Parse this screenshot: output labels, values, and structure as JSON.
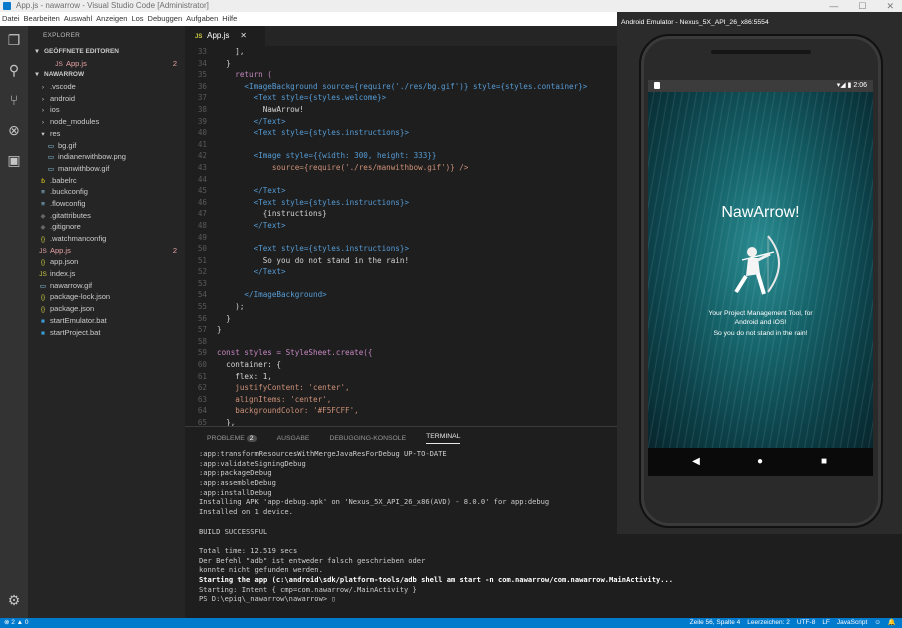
{
  "window": {
    "title": "App.js - nawarrow - Visual Studio Code [Administrator]",
    "controls": [
      "—",
      "☐",
      "✕"
    ]
  },
  "menu": [
    "Datei",
    "Bearbeiten",
    "Auswahl",
    "Anzeigen",
    "Los",
    "Debuggen",
    "Aufgaben",
    "Hilfe"
  ],
  "activity": {
    "icons": [
      "files-icon",
      "search-icon",
      "source-control-icon",
      "debug-icon",
      "extensions-icon",
      "settings-gear-icon"
    ]
  },
  "sidebar": {
    "header": "EXPLORER",
    "rows": [
      {
        "label": "GEÖFFNETE EDITOREN",
        "kind": "section",
        "indent": 4,
        "arrow": "▾"
      },
      {
        "label": "App.js",
        "kind": "file",
        "indent": 26,
        "icon": "JS",
        "color": "#e8a3a3",
        "count": "2"
      },
      {
        "label": "NAWARROW",
        "kind": "section",
        "indent": 4,
        "arrow": "▾"
      },
      {
        "label": ".vscode",
        "kind": "folder",
        "indent": 10,
        "arrow": "›"
      },
      {
        "label": "android",
        "kind": "folder",
        "indent": 10,
        "arrow": "›"
      },
      {
        "label": "ios",
        "kind": "folder",
        "indent": 10,
        "arrow": "›"
      },
      {
        "label": "node_modules",
        "kind": "folder",
        "indent": 10,
        "arrow": "›"
      },
      {
        "label": "res",
        "kind": "folder",
        "indent": 10,
        "arrow": "▾"
      },
      {
        "label": "bg.gif",
        "kind": "file",
        "indent": 18,
        "icon": "▭"
      },
      {
        "label": "indianerwithbow.png",
        "kind": "file",
        "indent": 18,
        "icon": "▭"
      },
      {
        "label": "manwithbow.gif",
        "kind": "file",
        "indent": 18,
        "icon": "▭"
      },
      {
        "label": ".babelrc",
        "kind": "file",
        "indent": 10,
        "icon": "ɓ",
        "iconColor": "#f5de19"
      },
      {
        "label": ".buckconfig",
        "kind": "file",
        "indent": 10,
        "icon": "≡"
      },
      {
        "label": ".flowconfig",
        "kind": "file",
        "indent": 10,
        "icon": "≡"
      },
      {
        "label": ".gitattributes",
        "kind": "file",
        "indent": 10,
        "icon": "◆",
        "iconColor": "#666"
      },
      {
        "label": ".gitignore",
        "kind": "file",
        "indent": 10,
        "icon": "◆",
        "iconColor": "#666"
      },
      {
        "label": ".watchmanconfig",
        "kind": "file",
        "indent": 10,
        "icon": "{}",
        "iconColor": "#cbcb41"
      },
      {
        "label": "App.js",
        "kind": "file",
        "indent": 10,
        "icon": "JS",
        "color": "#e8a3a3",
        "count": "2"
      },
      {
        "label": "app.json",
        "kind": "file",
        "indent": 10,
        "icon": "{}",
        "iconColor": "#cbcb41"
      },
      {
        "label": "index.js",
        "kind": "file",
        "indent": 10,
        "icon": "JS",
        "iconColor": "#cbcb41"
      },
      {
        "label": "nawarrow.gif",
        "kind": "file",
        "indent": 10,
        "icon": "▭"
      },
      {
        "label": "package-lock.json",
        "kind": "file",
        "indent": 10,
        "icon": "{}",
        "iconColor": "#cbcb41"
      },
      {
        "label": "package.json",
        "kind": "file",
        "indent": 10,
        "icon": "{}",
        "iconColor": "#cbcb41"
      },
      {
        "label": "startEmulator.bat",
        "kind": "file",
        "indent": 10,
        "icon": "■",
        "iconColor": "#3c9bd6"
      },
      {
        "label": "startProject.bat",
        "kind": "file",
        "indent": 10,
        "icon": "■",
        "iconColor": "#3c9bd6"
      }
    ]
  },
  "editor": {
    "tab": {
      "label": "App.js",
      "icon": "JS",
      "close": "✕"
    },
    "lines": [
      {
        "n": "33",
        "t": "    ],"
      },
      {
        "n": "34",
        "t": "  }"
      },
      {
        "n": "35",
        "t": "    return ("
      },
      {
        "n": "36",
        "t": "      <ImageBackground source={require('./res/bg.gif')} style={styles.container}>"
      },
      {
        "n": "37",
        "t": "        <Text style={styles.welcome}>"
      },
      {
        "n": "38",
        "t": "          NawArrow!"
      },
      {
        "n": "39",
        "t": "        </Text>"
      },
      {
        "n": "40",
        "t": "        <Text style={styles.instructions}>"
      },
      {
        "n": "41",
        "t": ""
      },
      {
        "n": "42",
        "t": "        <Image style={{width: 300, height: 333}}"
      },
      {
        "n": "43",
        "t": "            source={require('./res/manwithbow.gif')} />"
      },
      {
        "n": "44",
        "t": ""
      },
      {
        "n": "45",
        "t": "        </Text>"
      },
      {
        "n": "46",
        "t": "        <Text style={styles.instructions}>"
      },
      {
        "n": "47",
        "t": "          {instructions}"
      },
      {
        "n": "48",
        "t": "        </Text>"
      },
      {
        "n": "49",
        "t": ""
      },
      {
        "n": "50",
        "t": "        <Text style={styles.instructions}>"
      },
      {
        "n": "51",
        "t": "          So you do not stand in the rain!"
      },
      {
        "n": "52",
        "t": "        </Text>"
      },
      {
        "n": "53",
        "t": ""
      },
      {
        "n": "54",
        "t": "      </ImageBackground>"
      },
      {
        "n": "55",
        "t": "    );"
      },
      {
        "n": "56",
        "t": "  }"
      },
      {
        "n": "57",
        "t": "}"
      },
      {
        "n": "58",
        "t": ""
      },
      {
        "n": "59",
        "t": "const styles = StyleSheet.create({"
      },
      {
        "n": "60",
        "t": "  container: {"
      },
      {
        "n": "61",
        "t": "    flex: 1,"
      },
      {
        "n": "62",
        "t": "    justifyContent: 'center',"
      },
      {
        "n": "63",
        "t": "    alignItems: 'center',"
      },
      {
        "n": "64",
        "t": "    backgroundColor: '#F5FCFF',"
      },
      {
        "n": "65",
        "t": "  },"
      }
    ]
  },
  "panel": {
    "tabs": [
      {
        "label": "PROBLEME",
        "badge": "2"
      },
      {
        "label": "AUSGABE"
      },
      {
        "label": "DEBUGGING-KONSOLE"
      },
      {
        "label": "TERMINAL",
        "active": true
      }
    ],
    "terminal": [
      {
        "t": ":app:transformResourcesWithMergeJavaResForDebug UP-TO-DATE"
      },
      {
        "t": ":app:validateSigningDebug"
      },
      {
        "t": ":app:packageDebug"
      },
      {
        "t": ":app:assembleDebug"
      },
      {
        "t": ":app:installDebug"
      },
      {
        "t": "Installing APK 'app-debug.apk' on 'Nexus_5X_API_26_x86(AVD) - 8.0.0' for app:debug"
      },
      {
        "t": "Installed on 1 device."
      },
      {
        "t": ""
      },
      {
        "t": "BUILD SUCCESSFUL"
      },
      {
        "t": ""
      },
      {
        "t": "Total time: 12.519 secs"
      },
      {
        "t": "Der Befehl \"adb\" ist entweder falsch geschrieben oder"
      },
      {
        "t": "konnte nicht gefunden werden."
      },
      {
        "t": "Starting the app (c:\\android\\sdk/platform-tools/adb shell am start -n com.nawarrow/com.nawarrow.MainActivity...",
        "bold": true
      },
      {
        "t": "Starting: Intent { cmp=com.nawarrow/.MainActivity }"
      },
      {
        "t": "PS D:\\epiq\\_nawarrow\\nawarrow> ▯"
      }
    ]
  },
  "statusbar": {
    "left": "⊗ 2  ▲ 0",
    "items": [
      "Zeile 56, Spalte 4",
      "Leerzeichen: 2",
      "UTF-8",
      "LF",
      "JavaScript",
      "☺",
      "🔔"
    ]
  },
  "emulator": {
    "title": "Android Emulator - Nexus_5X_API_26_x86:5554",
    "status_time": "2:06",
    "status_icons": "▾◢ ▮",
    "welcome": "NawArrow!",
    "instructions": "Your Project Management Tool, for Android and iOS!",
    "rain_text": "So you do not stand in the rain!",
    "nav": {
      "back": "◀",
      "home": "●",
      "recent": "■"
    }
  },
  "colors": {
    "accent": "#007acc",
    "keyword": "#569cd6",
    "string": "#ce9178",
    "tag": "#569cd6",
    "attr": "#9cdcfe"
  }
}
